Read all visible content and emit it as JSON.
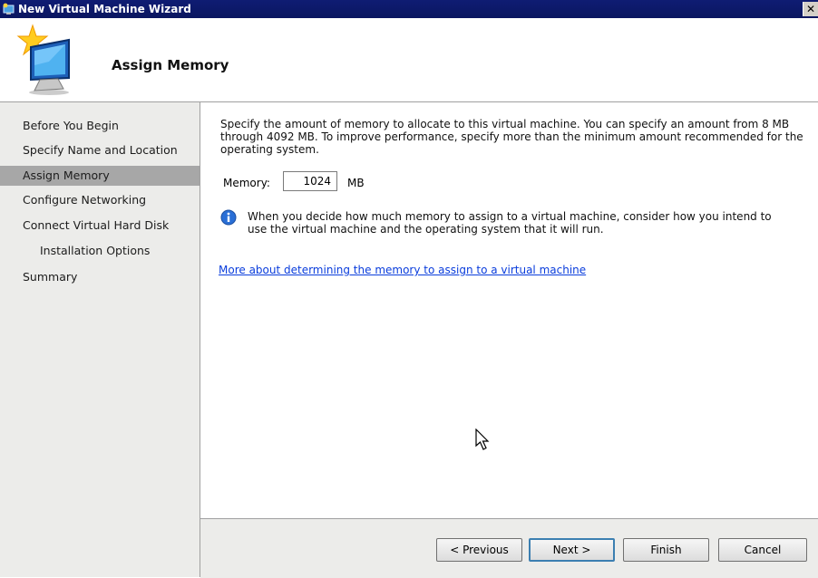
{
  "window": {
    "title": "New Virtual Machine Wizard",
    "close_glyph": "✕"
  },
  "header": {
    "title": "Assign Memory"
  },
  "sidebar": {
    "items": [
      {
        "label": "Before You Begin"
      },
      {
        "label": "Specify Name and Location"
      },
      {
        "label": "Assign Memory",
        "active": true
      },
      {
        "label": "Configure Networking"
      },
      {
        "label": "Connect Virtual Hard Disk"
      },
      {
        "label": "Installation Options",
        "indented": true
      },
      {
        "label": "Summary"
      }
    ]
  },
  "content": {
    "description": "Specify the amount of memory to allocate to this virtual machine. You can specify an amount from 8 MB through 4092 MB. To improve performance, specify more than the minimum amount recommended for the operating system.",
    "memory_label": "Memory:",
    "memory_value": "1024",
    "memory_unit": "MB",
    "info_text": "When you decide how much memory to assign to a virtual machine, consider how you intend to use the virtual machine and the operating system that it will run.",
    "link_text": "More about determining the memory to assign to a virtual machine"
  },
  "footer": {
    "previous_label": "< Previous",
    "next_label": "Next >",
    "finish_label": "Finish",
    "cancel_label": "Cancel"
  },
  "icons": {
    "title": "virtual-machine-icon",
    "header": "monitor-star-icon",
    "info": "info-icon",
    "cursor": "mouse-pointer-icon"
  },
  "colors": {
    "titlebar": "#0f1c73",
    "sidebar_bg": "#ececea",
    "active_item": "#a7a7a7",
    "link": "#0a3ddc"
  }
}
